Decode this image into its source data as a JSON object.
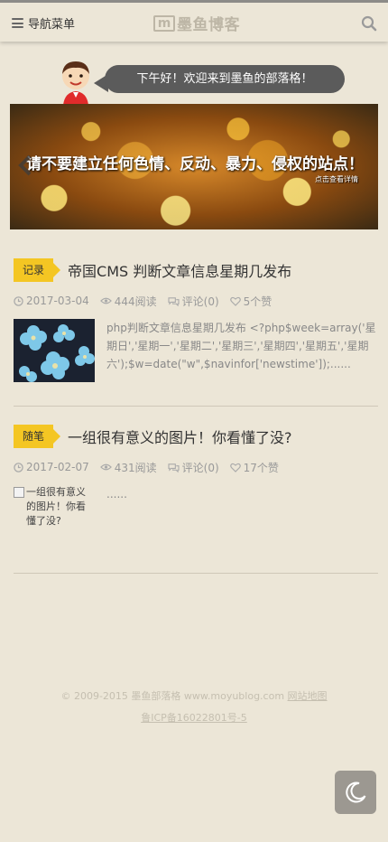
{
  "header": {
    "nav_label": "导航菜单",
    "logo_mark": "m",
    "logo_text": "墨鱼博客"
  },
  "greeting": {
    "text": "下午好！欢迎来到墨鱼的部落格！"
  },
  "banner": {
    "text": "请不要建立任何色情、反动、暴力、侵权的站点！",
    "sub": "点击查看详情"
  },
  "articles": [
    {
      "category": "记录",
      "title": "帝国CMS 判断文章信息星期几发布",
      "date": "2017-03-04",
      "views": "444阅读",
      "comments": "评论(0)",
      "likes": "5个赞",
      "excerpt": "php判断文章信息星期几发布 <?php$week=array('星期日','星期一','星期二','星期三','星期四','星期五','星期六');$w=date(\"w\",$navinfor['newstime']);......"
    },
    {
      "category": "随笔",
      "title": "一组很有意义的图片！你看懂了没?",
      "date": "2017-02-07",
      "views": "431阅读",
      "comments": "评论(0)",
      "likes": "17个赞",
      "thumb_alt": "一组很有意义的图片！你看懂了没?",
      "excerpt": "......"
    }
  ],
  "footer": {
    "copyright": "© 2009-2015 墨鱼部落格 www.moyublog.com",
    "sitemap": "网站地图",
    "icp": "鲁ICP备16022801号-5"
  },
  "colors": {
    "background": "#ece6d7",
    "tag": "#f4c623",
    "bubble": "#5b5b5b",
    "night_button": "#9c9891"
  }
}
